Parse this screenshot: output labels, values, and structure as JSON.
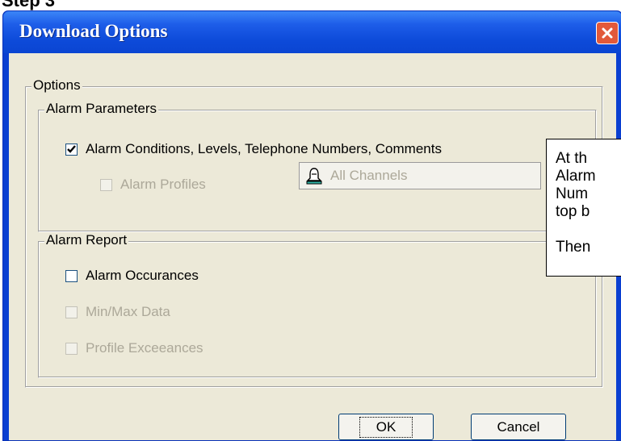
{
  "page": {
    "step_label": "Step 3"
  },
  "dialog": {
    "title": "Download Options",
    "options_group": "Options",
    "alarm_parameters": {
      "group_label": "Alarm Parameters",
      "alarm_conditions": {
        "label": "Alarm Conditions, Levels, Telephone Numbers, Comments",
        "checked": true
      },
      "alarm_profiles": {
        "label": "Alarm Profiles",
        "checked": false,
        "enabled": false
      },
      "channel_selector": {
        "label": "All Channels",
        "icon": "alarm-bell-icon"
      }
    },
    "alarm_report": {
      "group_label": "Alarm Report",
      "alarm_occurances": {
        "label": "Alarm Occurances",
        "checked": false
      },
      "min_max_data": {
        "label": "Min/Max Data",
        "checked": false,
        "enabled": false
      },
      "profile_exceeances": {
        "label": "Profile Exceeances",
        "checked": false,
        "enabled": false
      }
    },
    "buttons": {
      "ok": "OK",
      "cancel": "Cancel"
    }
  },
  "callout": {
    "lines": [
      "At th",
      "Alarm",
      "Num",
      "top b",
      "",
      "Then"
    ]
  },
  "colors": {
    "titlebar": "#0a45d2",
    "client": "#ece9d8",
    "close_button": "#e2593a"
  }
}
